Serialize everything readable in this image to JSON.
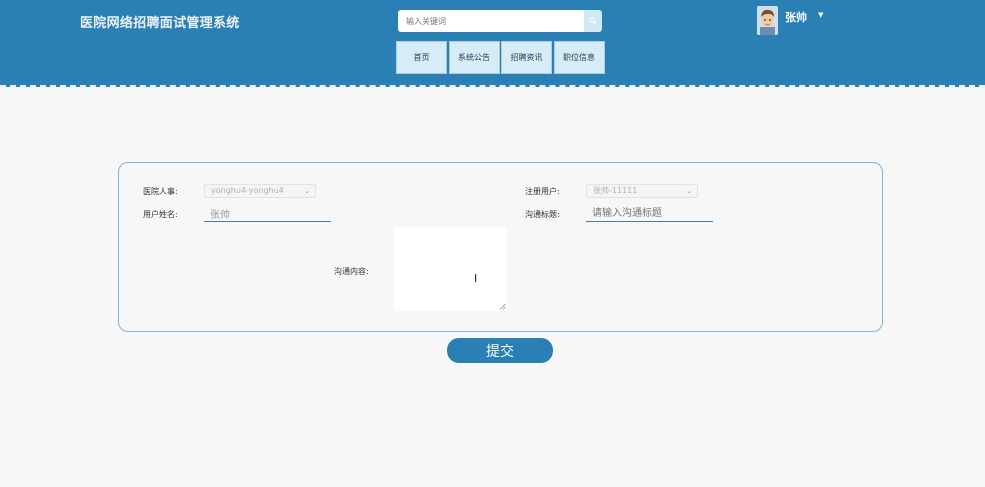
{
  "header": {
    "title": "医院网络招聘面试管理系统",
    "search": {
      "placeholder": "输入关键词"
    },
    "nav": [
      {
        "label": "首页"
      },
      {
        "label": "系统公告"
      },
      {
        "label": "招聘资讯"
      },
      {
        "label": "职位信息"
      }
    ],
    "user": {
      "name": "张帅"
    }
  },
  "form": {
    "hr": {
      "label": "医院人事:",
      "value": "yonghu4-yonghu4"
    },
    "registered_user": {
      "label": "注册用户:",
      "value": "张帅-11111"
    },
    "user_name": {
      "label": "用户姓名:",
      "value": "张帅"
    },
    "subject": {
      "label": "沟通标题:",
      "placeholder": "请输入沟通标题"
    },
    "content": {
      "label": "沟通内容:"
    },
    "submit_label": "提交"
  },
  "colors": {
    "header_bg": "#2a7fb5",
    "accent": "#2a7fb5"
  }
}
